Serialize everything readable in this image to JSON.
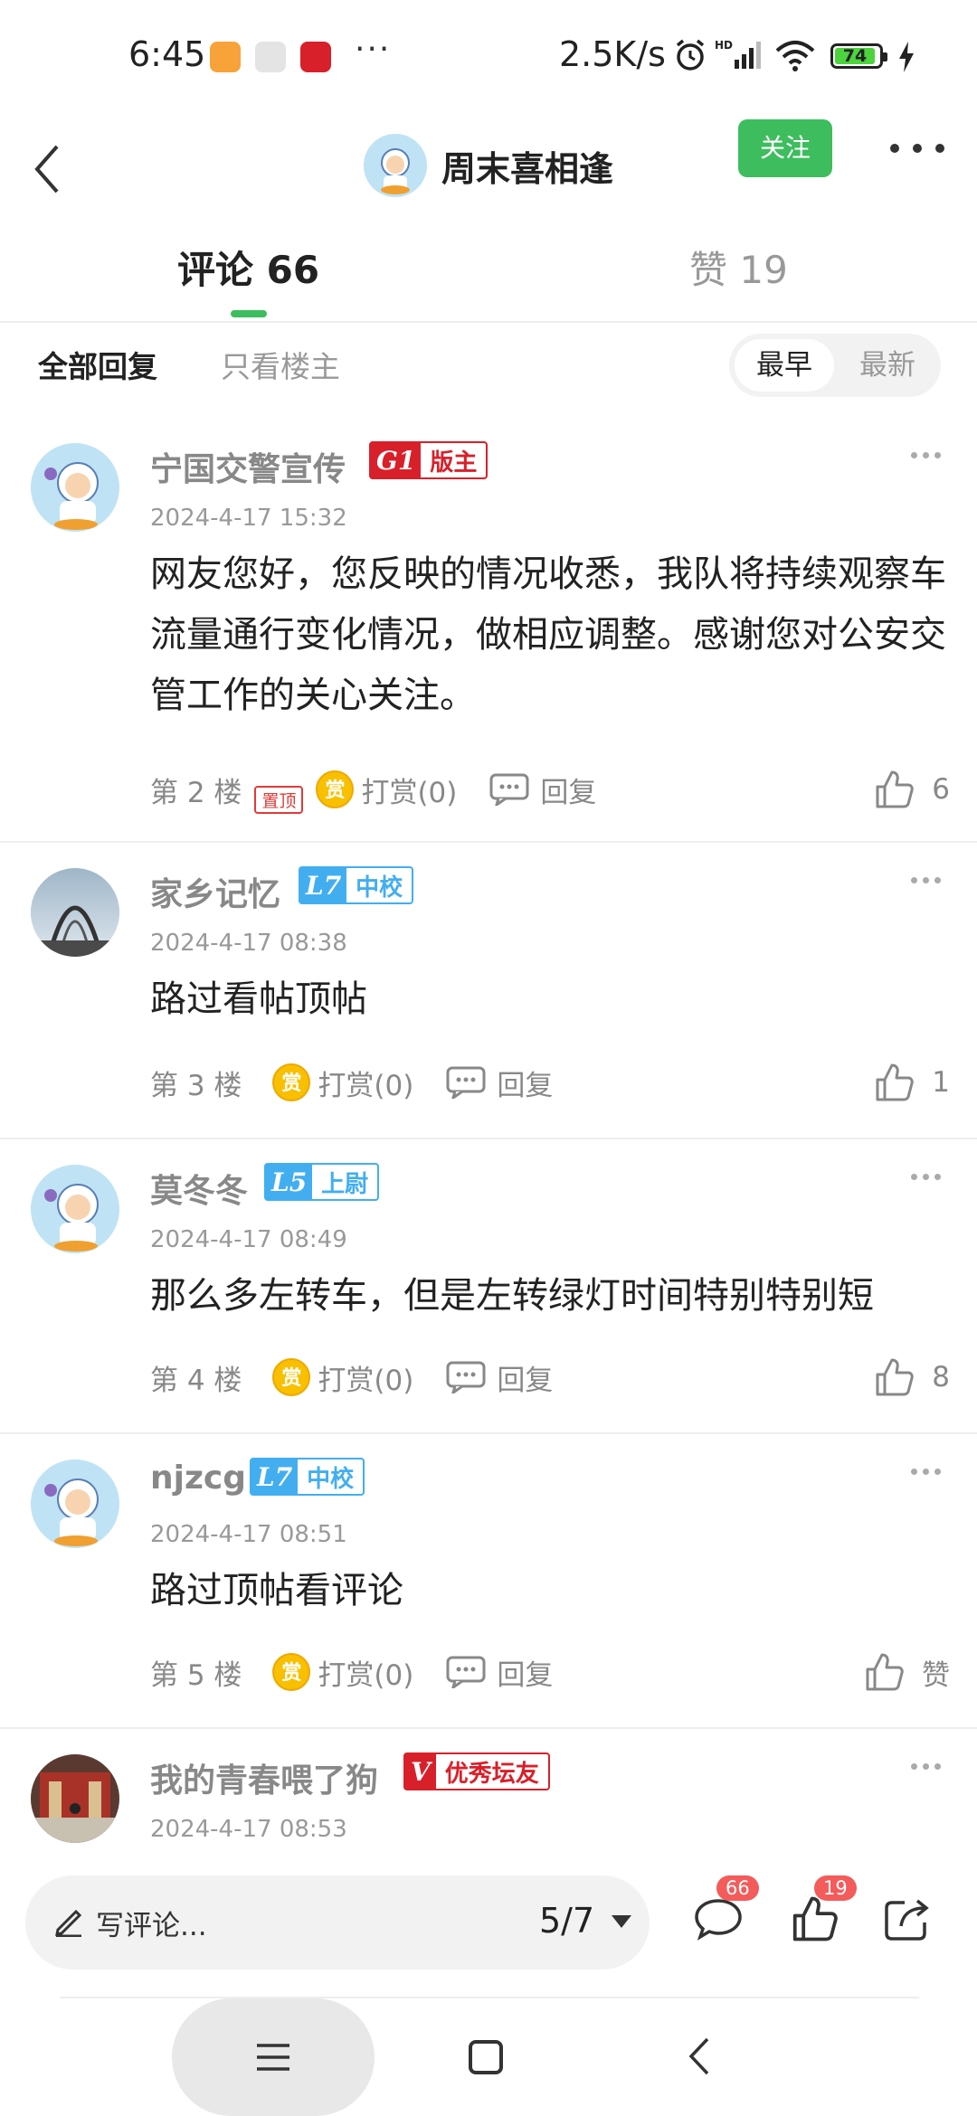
{
  "status_bar": {
    "time": "6:45",
    "dots": "···",
    "net_speed": "2.5K/s",
    "battery": "74",
    "icons": [
      "alarm-icon",
      "signal-icon",
      "wifi-icon",
      "charging-icon"
    ]
  },
  "header": {
    "title": "周末喜相逢",
    "follow_label": "关注"
  },
  "tabs": {
    "comments": "评论 66",
    "likes": "赞 19"
  },
  "filters": {
    "all": "全部回复",
    "owner_only": "只看楼主",
    "sort_earliest": "最早",
    "sort_latest": "最新"
  },
  "comments": [
    {
      "username": "宁国交警宣传",
      "badge_level": "G1",
      "badge_rank": "版主",
      "date": "2024-4-17 15:32",
      "text": "网友您好，您反映的情况收悉，我队将持续观察车流量通行变化情况，做相应调整。感谢您对公安交管工作的关心关注。",
      "floor": "第 2 楼",
      "pin_tag": "置顶",
      "reward_icon": "赏",
      "reward": "打赏(0)",
      "reply": "回复",
      "likes": "6"
    },
    {
      "username": "家乡记忆",
      "badge_level": "L7",
      "badge_rank": "中校",
      "date": "2024-4-17 08:38",
      "text": "路过看帖顶帖",
      "floor": "第 3 楼",
      "reward_icon": "赏",
      "reward": "打赏(0)",
      "reply": "回复",
      "likes": "1"
    },
    {
      "username": "莫冬冬",
      "badge_level": "L5",
      "badge_rank": "上尉",
      "date": "2024-4-17 08:49",
      "text": "那么多左转车，但是左转绿灯时间特别特别短",
      "floor": "第 4 楼",
      "reward_icon": "赏",
      "reward": "打赏(0)",
      "reply": "回复",
      "likes": "8"
    },
    {
      "username": "njzcg",
      "badge_level": "L7",
      "badge_rank": "中校",
      "date": "2024-4-17 08:51",
      "text": "路过顶帖看评论",
      "floor": "第 5 楼",
      "reward_icon": "赏",
      "reward": "打赏(0)",
      "reply": "回复",
      "likes": "赞"
    },
    {
      "username": "我的青春喂了狗",
      "badge_level": "V",
      "badge_rank": "优秀坛友",
      "date": "2024-4-17 08:53"
    }
  ],
  "bottom_bar": {
    "placeholder": "写评论...",
    "page": "5/7",
    "comment_count": "66",
    "like_count": "19"
  },
  "colors": {
    "accent": "#3dbd5d",
    "moderator_badge": "#d8202a",
    "level_badge": "#42aef0"
  }
}
